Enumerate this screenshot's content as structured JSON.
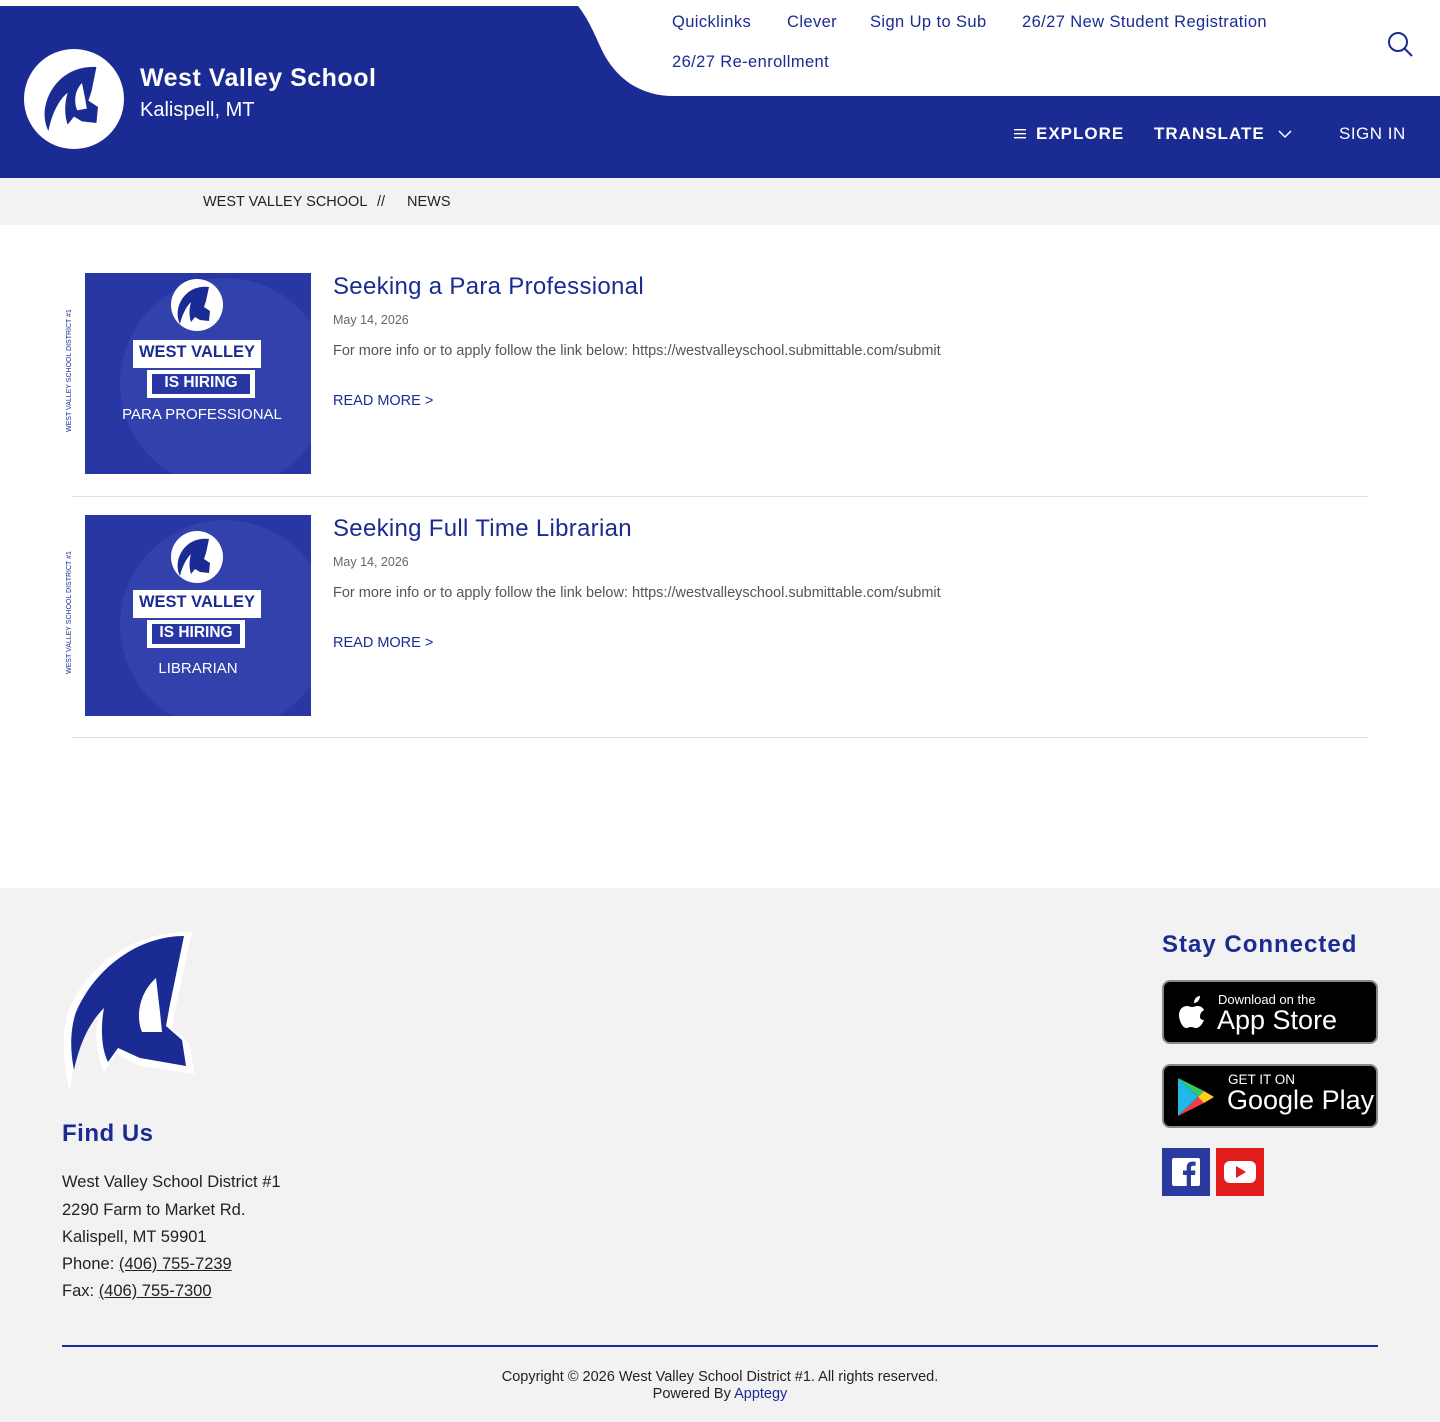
{
  "header": {
    "school_name": "West Valley School",
    "location": "Kalispell, MT",
    "quick_links": [
      "Quicklinks",
      "Clever",
      "Sign Up to Sub",
      "26/27 New Student Registration",
      "26/27 Re-enrollment"
    ],
    "nav": {
      "explore": "EXPLORE",
      "translate": "TRANSLATE",
      "sign_in": "SIGN IN"
    }
  },
  "breadcrumb": {
    "items": [
      "WEST VALLEY SCHOOL",
      "NEWS"
    ],
    "separator": "//"
  },
  "news": [
    {
      "title": "Seeking a Para Professional",
      "date": "May 14, 2026",
      "description": "For more info or to apply follow the link below: https://westvalleyschool.submittable.com/submit",
      "read_more": "READ MORE >",
      "thumb": {
        "line1": "WEST VALLEY",
        "line2": "IS HIRING",
        "line3": "PARA PROFESSIONAL",
        "side": "WEST VALLEY SCHOOL DISTRICT #1"
      }
    },
    {
      "title": "Seeking Full Time Librarian",
      "date": "May 14, 2026",
      "description": "For more info or to apply follow the link below: https://westvalleyschool.submittable.com/submit",
      "read_more": "READ MORE >",
      "thumb": {
        "line1": "WEST VALLEY",
        "line2": "IS HIRING",
        "line3": "LIBRARIAN",
        "side": "WEST VALLEY SCHOOL DISTRICT #1"
      }
    }
  ],
  "footer": {
    "find_us": "Find Us",
    "address": {
      "name": "West Valley School District #1",
      "street": "2290 Farm to Market Rd.",
      "city": "Kalispell, MT 59901",
      "phone_label": "Phone: ",
      "phone": "(406) 755-7239",
      "fax_label": "Fax: ",
      "fax": "(406) 755-7300"
    },
    "stay_connected": "Stay Connected",
    "app_store": {
      "small": "Download on the",
      "big": "App Store"
    },
    "google_play": {
      "small": "GET IT ON",
      "big": "Google Play"
    },
    "copyright": "Copyright © 2026 West Valley School District #1. All rights reserved.",
    "powered_by": "Powered By ",
    "powered_link": "Apptegy"
  },
  "colors": {
    "brand": "#1b2b94",
    "thumb": "#2837a4",
    "youtube": "#e31c1c",
    "facebook": "#2a3a9e"
  },
  "icons": [
    "search-icon",
    "menu-icon",
    "chevron-down-icon",
    "spartan-logo-icon",
    "apple-icon",
    "google-play-icon",
    "facebook-icon",
    "youtube-icon"
  ]
}
